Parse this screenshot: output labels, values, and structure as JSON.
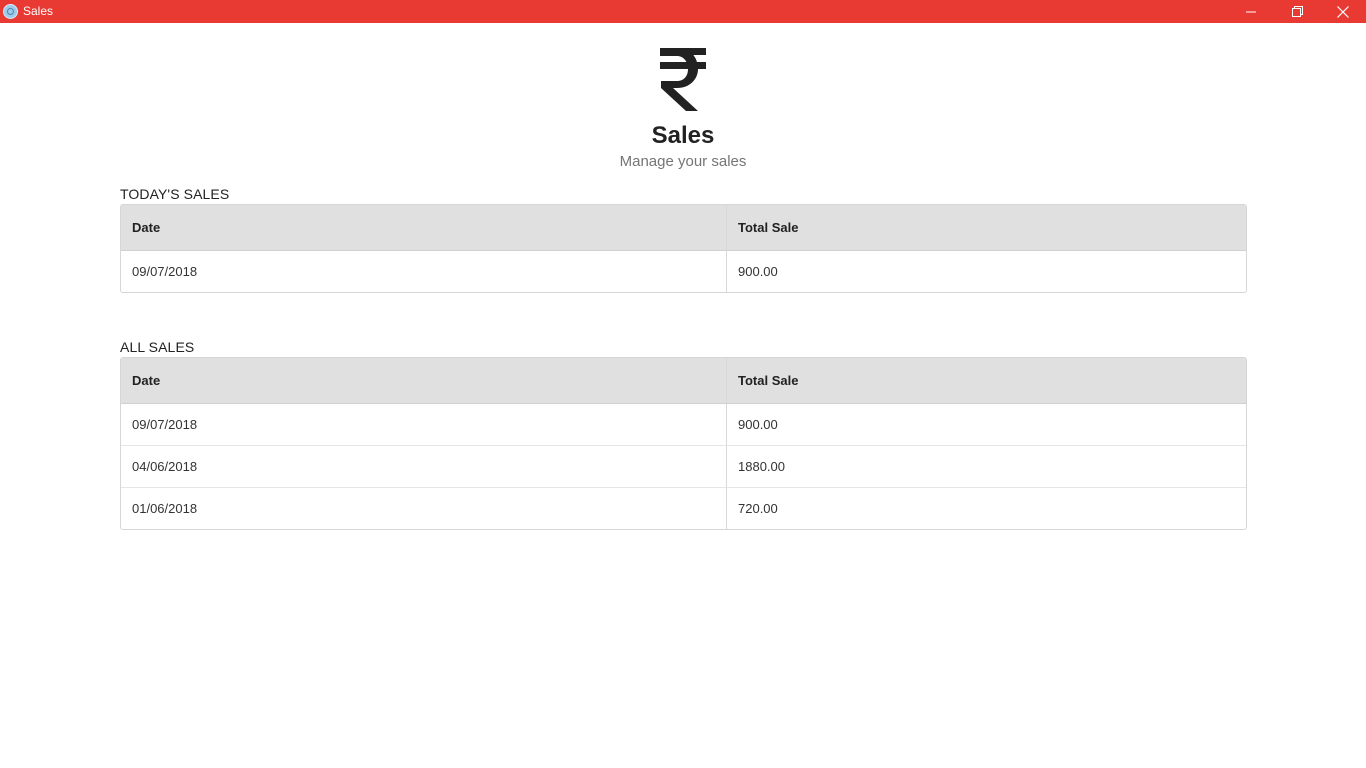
{
  "window": {
    "title": "Sales",
    "controls": [
      "minimize-icon",
      "restore-icon",
      "close-icon"
    ],
    "accent_color": "#e83a32"
  },
  "header": {
    "icon": "rupee-icon",
    "title": "Sales",
    "subtitle": "Manage your sales"
  },
  "todays_sales": {
    "label": "TODAY'S SALES",
    "columns": [
      "Date",
      "Total Sale"
    ],
    "rows": [
      [
        "09/07/2018",
        "900.00"
      ]
    ]
  },
  "all_sales": {
    "label": "ALL SALES",
    "columns": [
      "Date",
      "Total Sale"
    ],
    "rows": [
      [
        "09/07/2018",
        "900.00"
      ],
      [
        "04/06/2018",
        "1880.00"
      ],
      [
        "01/06/2018",
        "720.00"
      ]
    ]
  }
}
